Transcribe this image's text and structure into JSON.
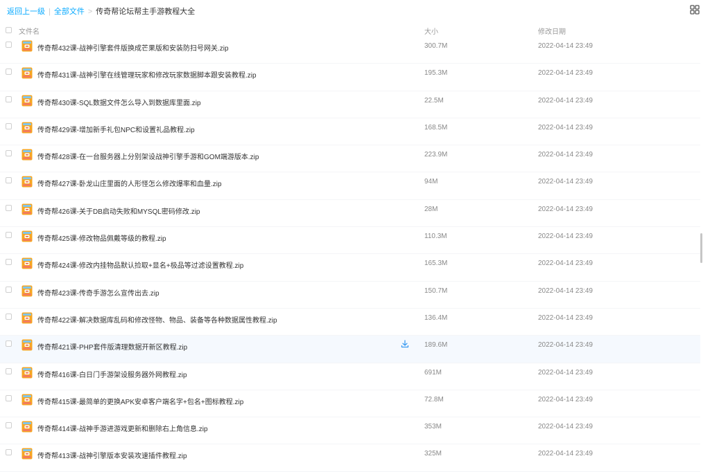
{
  "breadcrumb": {
    "back_label": "返回上一级",
    "separator": "|",
    "all_files_label": "全部文件",
    "arrow": ">",
    "current_folder": "传奇帮论坛帮主手游教程大全"
  },
  "toolbar": {
    "view_toggle_icon": "grid-view-icon"
  },
  "table": {
    "columns": {
      "name": "文件名",
      "size": "大小",
      "modified": "修改日期"
    },
    "rows": [
      {
        "name": "传奇帮432课-战神引擎套件版换成芒果版和安装防扫号网关.zip",
        "size": "300.7M",
        "date": "2022-04-14 23:49"
      },
      {
        "name": "传奇帮431课-战神引擎在线管理玩家和修改玩家数据脚本跟安装教程.zip",
        "size": "195.3M",
        "date": "2022-04-14 23:49"
      },
      {
        "name": "传奇帮430课-SQL数据文件怎么导入到数据库里面.zip",
        "size": "22.5M",
        "date": "2022-04-14 23:49"
      },
      {
        "name": "传奇帮429课-增加新手礼包NPC和设置礼品教程.zip",
        "size": "168.5M",
        "date": "2022-04-14 23:49"
      },
      {
        "name": "传奇帮428课-在一台服务器上分别架设战神引擎手游和GOM端游版本.zip",
        "size": "223.9M",
        "date": "2022-04-14 23:49"
      },
      {
        "name": "传奇帮427课-卧龙山庄里面的人形怪怎么修改爆率和血量.zip",
        "size": "94M",
        "date": "2022-04-14 23:49"
      },
      {
        "name": "传奇帮426课-关于DB启动失败和MYSQL密码修改.zip",
        "size": "28M",
        "date": "2022-04-14 23:49"
      },
      {
        "name": "传奇帮425课-修改物品佩戴等级的教程.zip",
        "size": "110.3M",
        "date": "2022-04-14 23:49"
      },
      {
        "name": "传奇帮424课-修改内挂物品默认捡取+显名+极品等过滤设置教程.zip",
        "size": "165.3M",
        "date": "2022-04-14 23:49"
      },
      {
        "name": "传奇帮423课-传奇手游怎么宣传出去.zip",
        "size": "150.7M",
        "date": "2022-04-14 23:49"
      },
      {
        "name": "传奇帮422课-解决数据库乱码和修改怪物、物品、装备等各种数据属性教程.zip",
        "size": "136.4M",
        "date": "2022-04-14 23:49"
      },
      {
        "name": "传奇帮421课-PHP套件版清理数据开新区教程.zip",
        "size": "189.6M",
        "date": "2022-04-14 23:49",
        "hover": true
      },
      {
        "name": "传奇帮416课-白日门手游架设服务器外网教程.zip",
        "size": "691M",
        "date": "2022-04-14 23:49"
      },
      {
        "name": "传奇帮415课-最简单的更换APK安卓客户端名字+包名+图标教程.zip",
        "size": "72.8M",
        "date": "2022-04-14 23:49"
      },
      {
        "name": "传奇帮414课-战神手游进游戏更新和删除右上角信息.zip",
        "size": "353M",
        "date": "2022-04-14 23:49"
      },
      {
        "name": "传奇帮413课-战神引擎版本安装攻速插件教程.zip",
        "size": "325M",
        "date": "2022-04-14 23:49"
      }
    ]
  },
  "icons": {
    "file": "zip-file-icon",
    "download": "download-icon",
    "checkbox": "checkbox"
  },
  "colors": {
    "link": "#09aaff",
    "text": "#333333",
    "muted": "#888888",
    "hover_row": "#f5f9fe",
    "zip_icon_orange": "#f6a623"
  }
}
